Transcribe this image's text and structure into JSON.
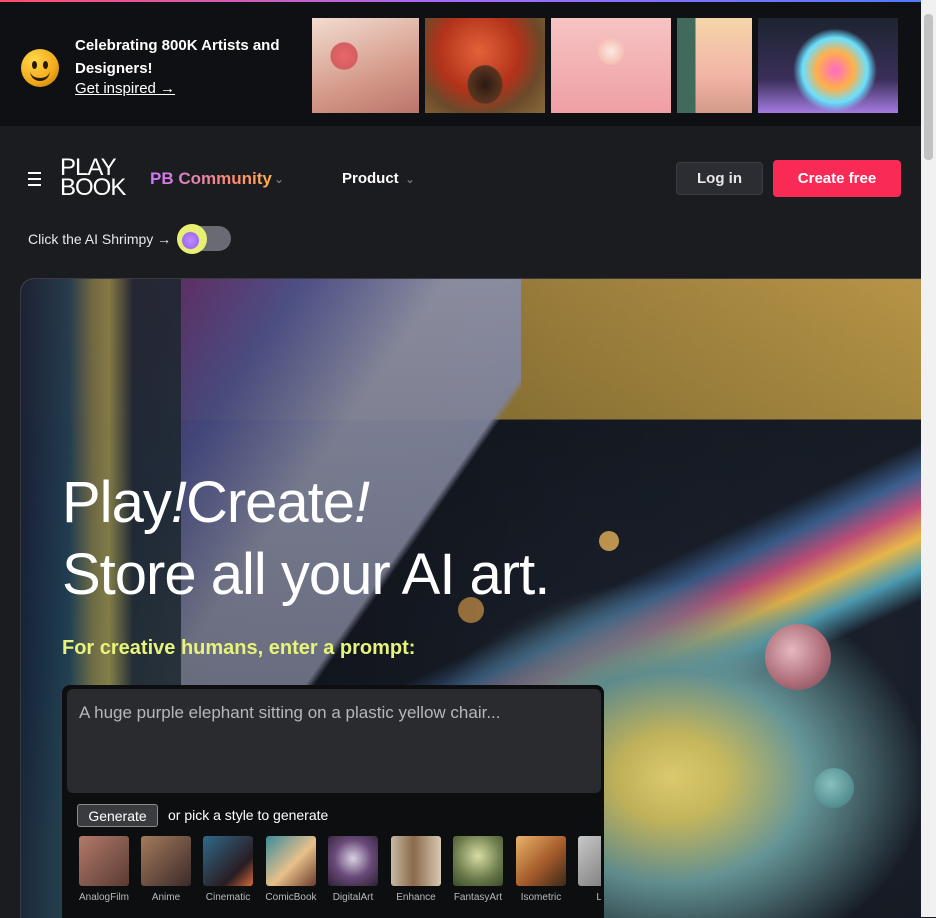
{
  "promo": {
    "title": "Celebrating 800K Artists and Designers!",
    "link": "Get inspired →"
  },
  "nav": {
    "logo_line1": "PLAY",
    "logo_line2": "BOOK",
    "community": "PB Community",
    "product": "Product",
    "login": "Log in",
    "create": "Create free"
  },
  "shrimpy": {
    "text": "Click the AI Shrimpy →"
  },
  "hero": {
    "line1a": "Play",
    "line1b": "!",
    "line1c": "Create",
    "line1d": "!",
    "line2": "Store all your AI art.",
    "prompt_label": "For creative humans, enter a prompt:",
    "prompt_placeholder": "A huge purple elephant sitting on a plastic yellow chair...",
    "generate": "Generate",
    "pick_text": "or pick a style to generate"
  },
  "styles": [
    {
      "label": "AnalogFilm",
      "color": "#8a5a4a"
    },
    {
      "label": "Anime",
      "color": "#6b4a3a"
    },
    {
      "label": "Cinematic",
      "color": "#2f4a5a"
    },
    {
      "label": "ComicBook",
      "color": "#3a6a7a"
    },
    {
      "label": "DigitalArt",
      "color": "#5a4a6a"
    },
    {
      "label": "Enhance",
      "color": "#6a5a4a"
    },
    {
      "label": "FantasyArt",
      "color": "#7a8a5a"
    },
    {
      "label": "Isometric",
      "color": "#9a6a3a"
    },
    {
      "label": "Lin",
      "color": "#8a8a8a"
    }
  ]
}
